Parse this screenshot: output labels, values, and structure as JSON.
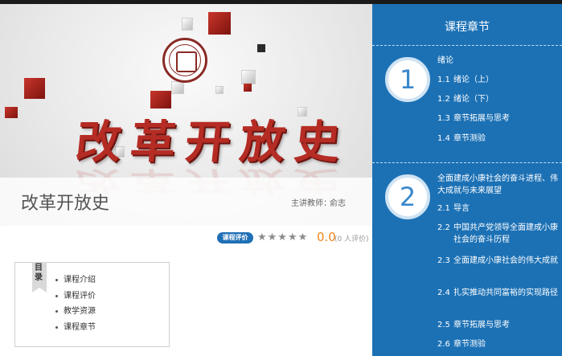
{
  "hero": {
    "art_text": "改革开放史",
    "course_title": "改革开放史",
    "teacher_label": "主讲教师：",
    "teacher_name": "俞志"
  },
  "rating": {
    "badge": "课程评价",
    "stars": "★★★★★",
    "score": "0.0",
    "count": "(0 人评价)"
  },
  "toc": {
    "tab_label": "目录",
    "items": [
      "课程介绍",
      "课程评价",
      "教学资源",
      "课程章节"
    ]
  },
  "chapters": {
    "title": "课程章节",
    "list": [
      {
        "number": "1",
        "heading": "绪论",
        "items": [
          {
            "num": "1.1",
            "label": "绪论（上）"
          },
          {
            "num": "1.2",
            "label": "绪论（下）"
          },
          {
            "num": "1.3",
            "label": "章节拓展与思考"
          },
          {
            "num": "1.4",
            "label": "章节测验"
          }
        ]
      },
      {
        "number": "2",
        "heading": "全面建成小康社会的奋斗进程、伟大成就与未来展望",
        "items": [
          {
            "num": "2.1",
            "label": "导言"
          },
          {
            "num": "2.2",
            "label": "中国共产党领导全面建成小康社会的奋斗历程"
          },
          {
            "num": "2.3",
            "label": "全面建成小康社会的伟大成就"
          },
          {
            "num": "2.4",
            "label": "扎实推动共同富裕的实现路径"
          },
          {
            "num": "2.5",
            "label": "章节拓展与思考"
          },
          {
            "num": "2.6",
            "label": "章节测验"
          }
        ]
      }
    ]
  }
}
